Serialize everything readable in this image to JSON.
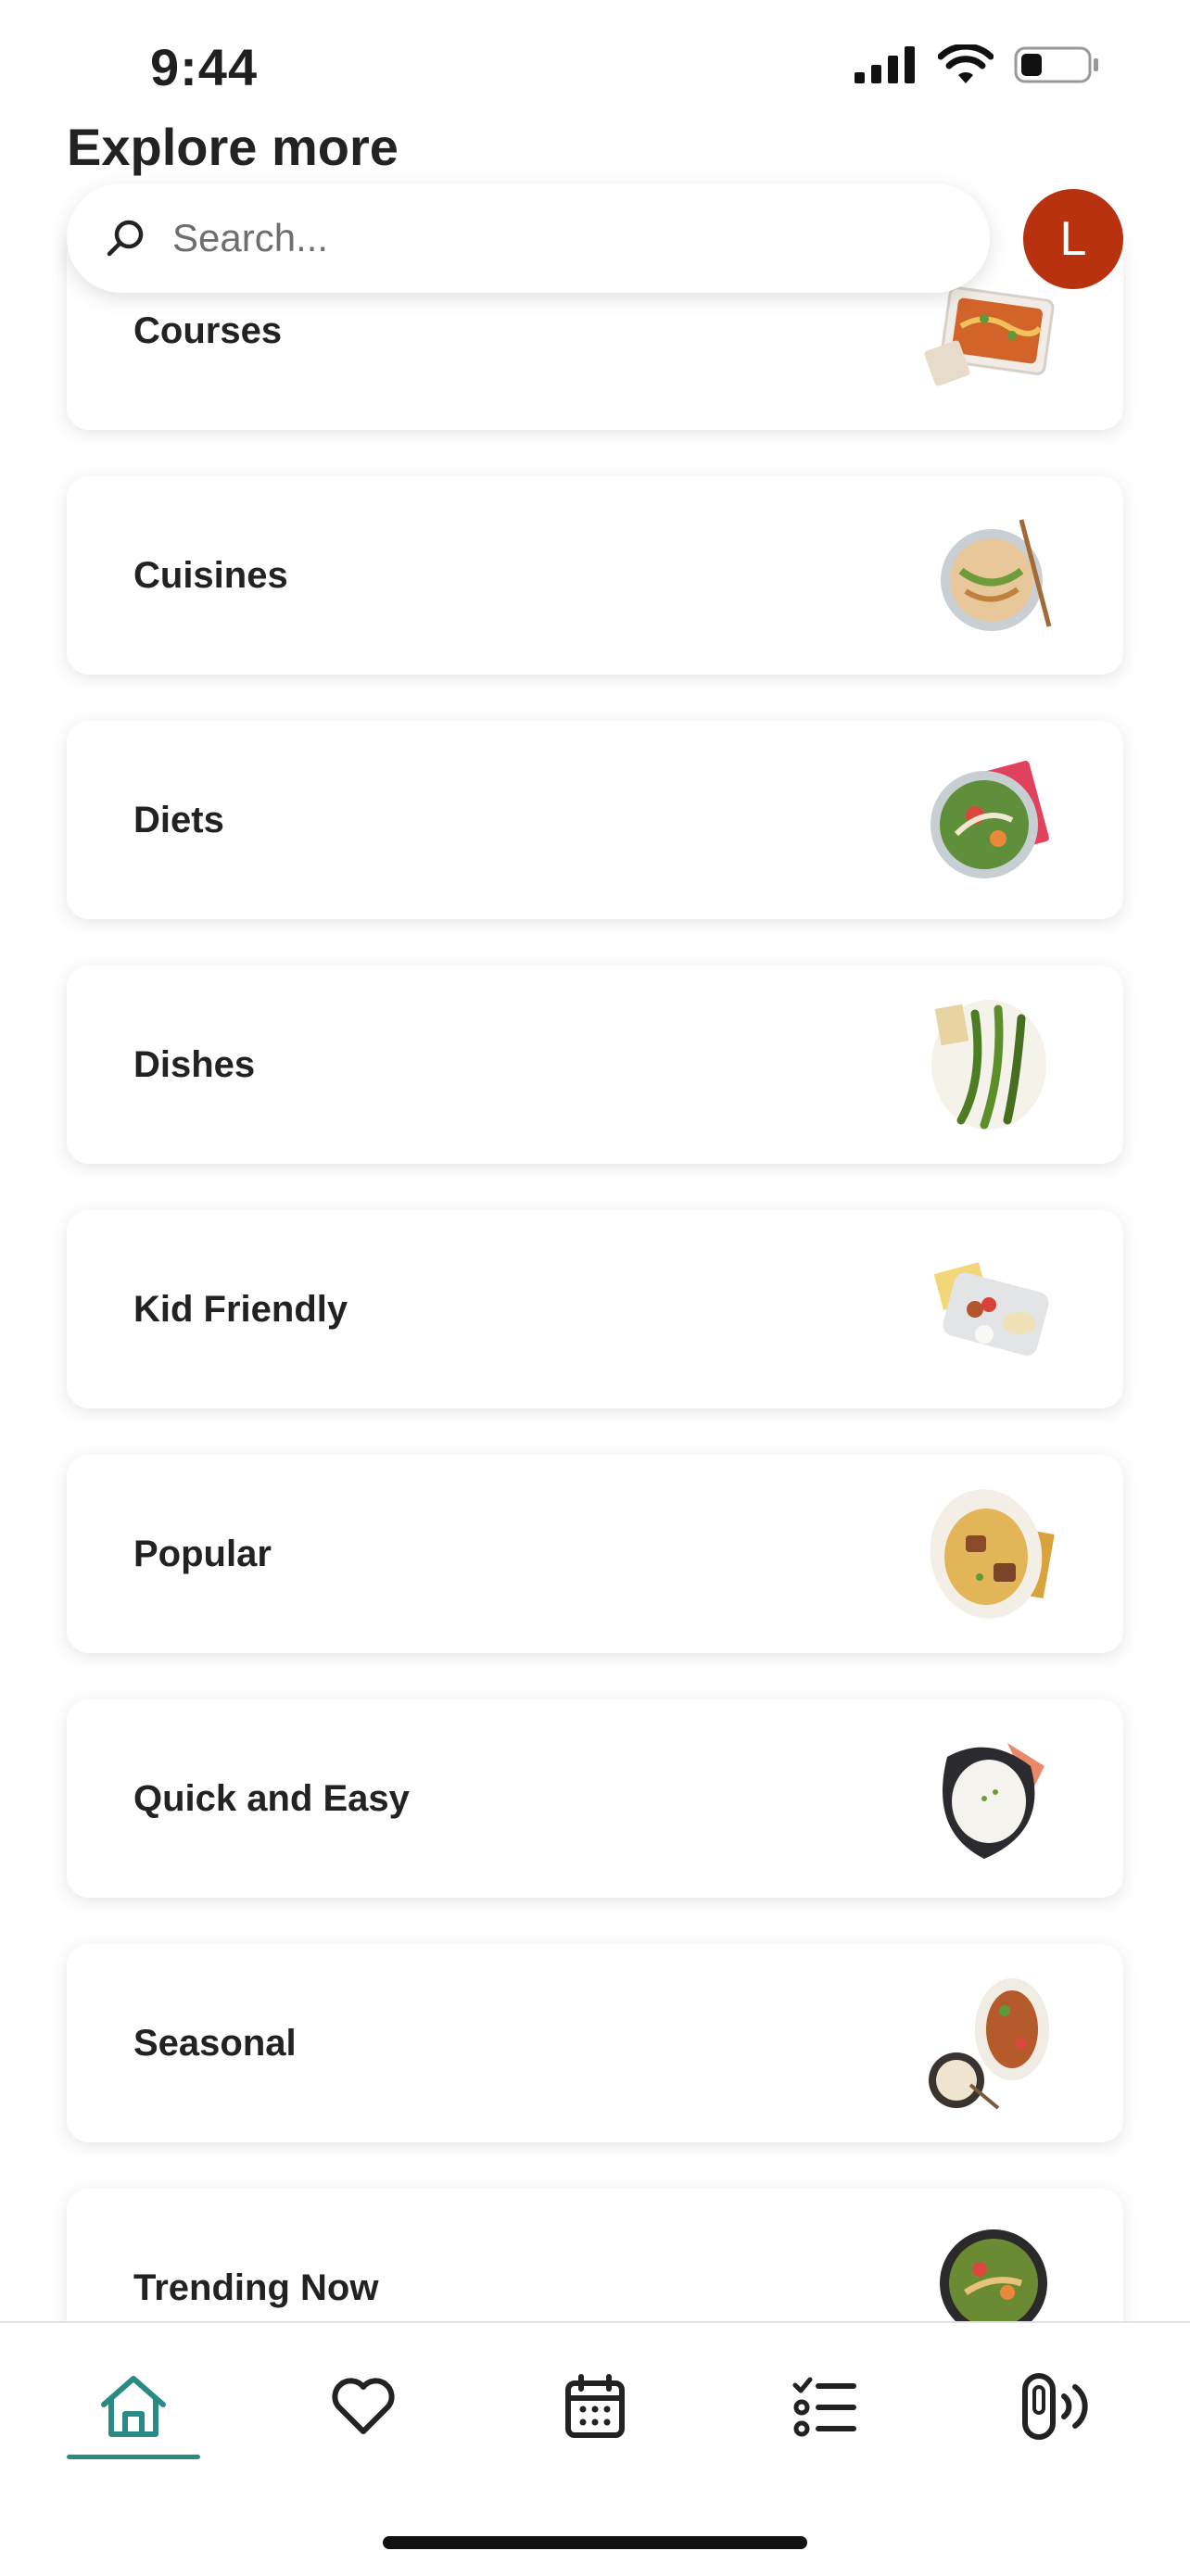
{
  "status_bar": {
    "time": "9:44"
  },
  "header": {
    "title": "Explore more",
    "search_placeholder": "Search...",
    "avatar_initial": "L"
  },
  "categories": [
    {
      "label": "Courses",
      "image": "enchilada-dish"
    },
    {
      "label": "Cuisines",
      "image": "noodle-bowl"
    },
    {
      "label": "Diets",
      "image": "salad-bowl"
    },
    {
      "label": "Dishes",
      "image": "asparagus-plate"
    },
    {
      "label": "Kid Friendly",
      "image": "kids-tray"
    },
    {
      "label": "Popular",
      "image": "pasta-plate"
    },
    {
      "label": "Quick and Easy",
      "image": "rice-bowl"
    },
    {
      "label": "Seasonal",
      "image": "roast-plate"
    },
    {
      "label": "Trending Now",
      "image": "stirfry-bowl"
    }
  ],
  "tab_bar": {
    "tabs": [
      {
        "name": "home",
        "icon": "home-icon",
        "active": true
      },
      {
        "name": "favorites",
        "icon": "heart-icon",
        "active": false
      },
      {
        "name": "planner",
        "icon": "calendar-icon",
        "active": false
      },
      {
        "name": "shopping-list",
        "icon": "checklist-icon",
        "active": false
      },
      {
        "name": "devices",
        "icon": "device-icon",
        "active": false
      }
    ]
  },
  "colors": {
    "accent": "#2a8a84",
    "avatar": "#b83210"
  }
}
